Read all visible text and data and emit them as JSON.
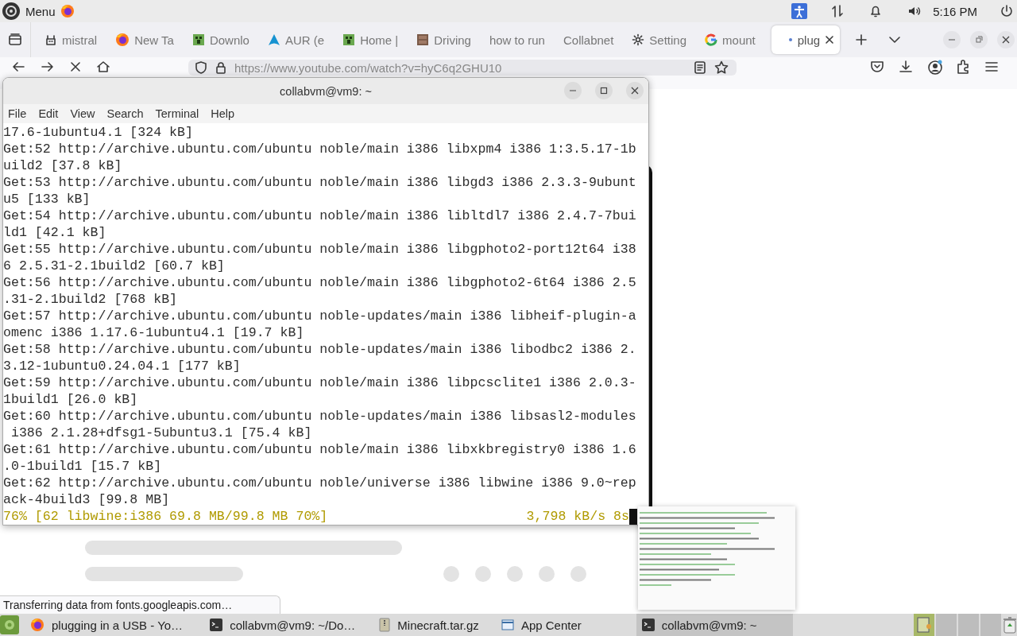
{
  "top_panel": {
    "menu_label": "Menu",
    "clock": "5:16 PM"
  },
  "browser": {
    "tabs": [
      {
        "label": "mistral",
        "kind": "robot",
        "selected": false
      },
      {
        "label": "New Ta",
        "kind": "firefox",
        "selected": false
      },
      {
        "label": "Downlo",
        "kind": "block",
        "selected": false
      },
      {
        "label": "AUR (e",
        "kind": "arch",
        "selected": false
      },
      {
        "label": "Home |",
        "kind": "block",
        "selected": false
      },
      {
        "label": "Driving",
        "kind": "crate",
        "selected": false
      },
      {
        "label": "how to run",
        "kind": "none",
        "selected": false
      },
      {
        "label": "Collabnet",
        "kind": "none",
        "selected": false
      },
      {
        "label": "Setting",
        "kind": "gear",
        "selected": false
      },
      {
        "label": "mount",
        "kind": "google",
        "selected": false
      },
      {
        "label": "plug",
        "kind": "loading",
        "selected": true
      }
    ],
    "url": "https://www.youtube.com/watch?v=hyC6q2GHU10",
    "status_text": "Transferring data from fonts.googleapis.com…"
  },
  "terminal": {
    "title": "collabvm@vm9: ~",
    "menu": [
      "File",
      "Edit",
      "View",
      "Search",
      "Terminal",
      "Help"
    ],
    "lines": [
      "17.6-1ubuntu4.1 [324 kB]",
      "Get:52 http://archive.ubuntu.com/ubuntu noble/main i386 libxpm4 i386 1:3.5.17-1b",
      "uild2 [37.8 kB]",
      "Get:53 http://archive.ubuntu.com/ubuntu noble/main i386 libgd3 i386 2.3.3-9ubunt",
      "u5 [133 kB]",
      "Get:54 http://archive.ubuntu.com/ubuntu noble/main i386 libltdl7 i386 2.4.7-7bui",
      "ld1 [42.1 kB]",
      "Get:55 http://archive.ubuntu.com/ubuntu noble/main i386 libgphoto2-port12t64 i38",
      "6 2.5.31-2.1build2 [60.7 kB]",
      "Get:56 http://archive.ubuntu.com/ubuntu noble/main i386 libgphoto2-6t64 i386 2.5",
      ".31-2.1build2 [768 kB]",
      "Get:57 http://archive.ubuntu.com/ubuntu noble-updates/main i386 libheif-plugin-a",
      "omenc i386 1.17.6-1ubuntu4.1 [19.7 kB]",
      "Get:58 http://archive.ubuntu.com/ubuntu noble-updates/main i386 libodbc2 i386 2.",
      "3.12-1ubuntu0.24.04.1 [177 kB]",
      "Get:59 http://archive.ubuntu.com/ubuntu noble/main i386 libpcsclite1 i386 2.0.3-",
      "1build1 [26.0 kB]",
      "Get:60 http://archive.ubuntu.com/ubuntu noble-updates/main i386 libsasl2-modules",
      " i386 2.1.28+dfsg1-5ubuntu3.1 [75.4 kB]",
      "Get:61 http://archive.ubuntu.com/ubuntu noble/main i386 libxkbregistry0 i386 1.6",
      ".0-1build1 [15.7 kB]",
      "Get:62 http://archive.ubuntu.com/ubuntu noble/universe i386 libwine i386 9.0~rep",
      "ack-4build3 [99.8 MB]"
    ],
    "progress": "76% [62 libwine:i386 69.8 MB/99.8 MB 70%]",
    "speed": "3,798 kB/s 8s"
  },
  "taskbar": {
    "items": [
      {
        "label": "plugging in a USB - Yo…",
        "kind": "firefox",
        "selected": false
      },
      {
        "label": "collabvm@vm9: ~/Do…",
        "kind": "terminal",
        "selected": false
      },
      {
        "label": "Minecraft.tar.gz",
        "kind": "archive",
        "selected": false
      },
      {
        "label": "App Center",
        "kind": "app",
        "selected": false
      },
      {
        "label": "collabvm@vm9: ~",
        "kind": "terminal",
        "selected": true
      }
    ]
  }
}
